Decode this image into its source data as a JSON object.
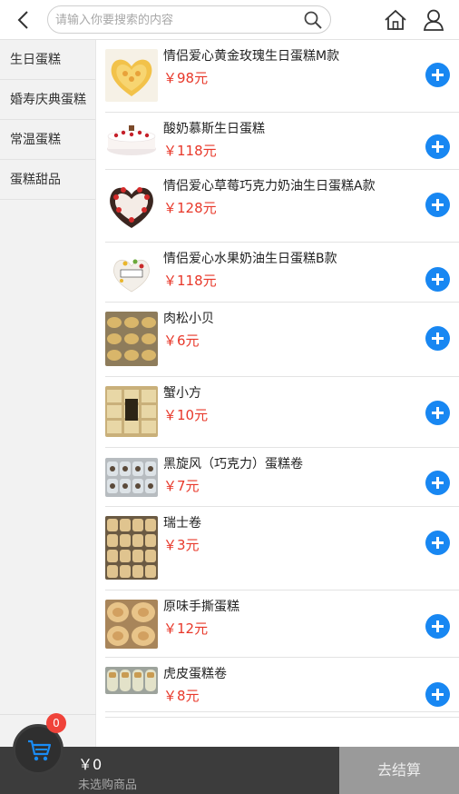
{
  "header": {
    "search_placeholder": "请输入你要搜索的内容",
    "back_icon": "chevron-left-icon",
    "search_icon": "search-icon",
    "home_icon": "home-icon",
    "user_icon": "user-icon"
  },
  "sidebar": {
    "items": [
      {
        "label": "生日蛋糕"
      },
      {
        "label": "婚寿庆典蛋糕"
      },
      {
        "label": "常温蛋糕"
      },
      {
        "label": "蛋糕甜品"
      }
    ]
  },
  "products": [
    {
      "name": "情侣爱心黄金玫瑰生日蛋糕M款",
      "price": "￥98元"
    },
    {
      "name": "酸奶慕斯生日蛋糕",
      "price": "￥118元"
    },
    {
      "name": "情侣爱心草莓巧克力奶油生日蛋糕A款",
      "price": "￥128元"
    },
    {
      "name": "情侣爱心水果奶油生日蛋糕B款",
      "price": "￥118元"
    },
    {
      "name": "肉松小贝",
      "price": "￥6元"
    },
    {
      "name": "蟹小方",
      "price": "￥10元"
    },
    {
      "name": "黑旋风（巧克力）蛋糕卷",
      "price": "￥7元"
    },
    {
      "name": "瑞士卷",
      "price": "￥3元"
    },
    {
      "name": "原味手撕蛋糕",
      "price": "￥12元"
    },
    {
      "name": "虎皮蛋糕卷",
      "price": "￥8元"
    }
  ],
  "cart": {
    "count": "0",
    "total": "￥0",
    "hint": "未选购商品",
    "checkout_label": "去结算",
    "cart_icon": "cart-icon"
  },
  "colors": {
    "accent": "#1887f2",
    "price": "#e8382a",
    "badge": "#f0433a",
    "bottom_bar": "#3c3c3c",
    "checkout": "#9a9a9a"
  }
}
